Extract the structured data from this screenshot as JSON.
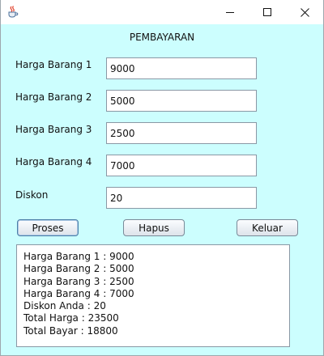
{
  "window": {
    "icon": "java-cup-icon",
    "controls": {
      "minimize": "minimize-icon",
      "maximize": "maximize-icon",
      "close": "close-icon"
    }
  },
  "form": {
    "title": "PEMBAYARAN",
    "fields": [
      {
        "label": "Harga Barang 1",
        "value": "9000"
      },
      {
        "label": "Harga Barang 2",
        "value": "5000"
      },
      {
        "label": "Harga Barang 3",
        "value": "2500"
      },
      {
        "label": "Harga Barang 4",
        "value": "7000"
      },
      {
        "label": "Diskon",
        "value": "20"
      }
    ],
    "buttons": {
      "proses": "Proses",
      "hapus": "Hapus",
      "keluar": "Keluar"
    }
  },
  "output": {
    "lines": [
      "Harga Barang 1 : 9000",
      "Harga Barang 2 : 5000",
      "Harga Barang 3 : 2500",
      "Harga Barang 4 : 7000",
      "Diskon Anda : 20",
      "Total Harga : 23500",
      "Total Bayar : 18800"
    ]
  },
  "colors": {
    "background": "#ccfefe",
    "titlebar": "#ffffff"
  }
}
